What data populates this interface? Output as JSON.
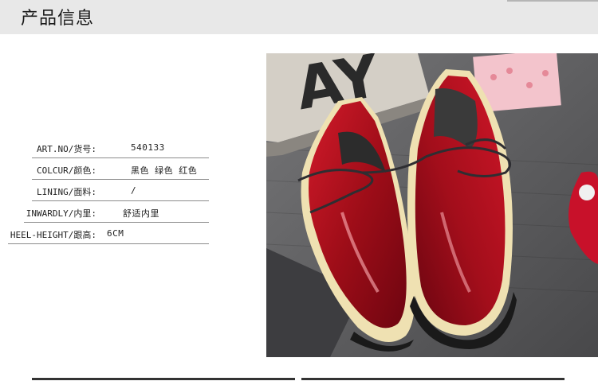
{
  "header": {
    "title": "产品信息"
  },
  "specs": [
    {
      "label": "ART.NO/货号:",
      "value": "540133"
    },
    {
      "label": "COLCUR/颜色:",
      "value": "黑色 绿色 红色"
    },
    {
      "label": "LINING/面料:",
      "value": "/"
    },
    {
      "label": "INWARDLY/内里:",
      "value": "舒适内里"
    },
    {
      "label": "HEEL-HEIGHT/跟高:",
      "value": "6CM"
    }
  ],
  "photo": {
    "sign_text": "AY"
  },
  "colors": {
    "shoe_red": "#b0101c",
    "sole": "#e9d9a4",
    "background_gray": "#5c5c5e"
  }
}
